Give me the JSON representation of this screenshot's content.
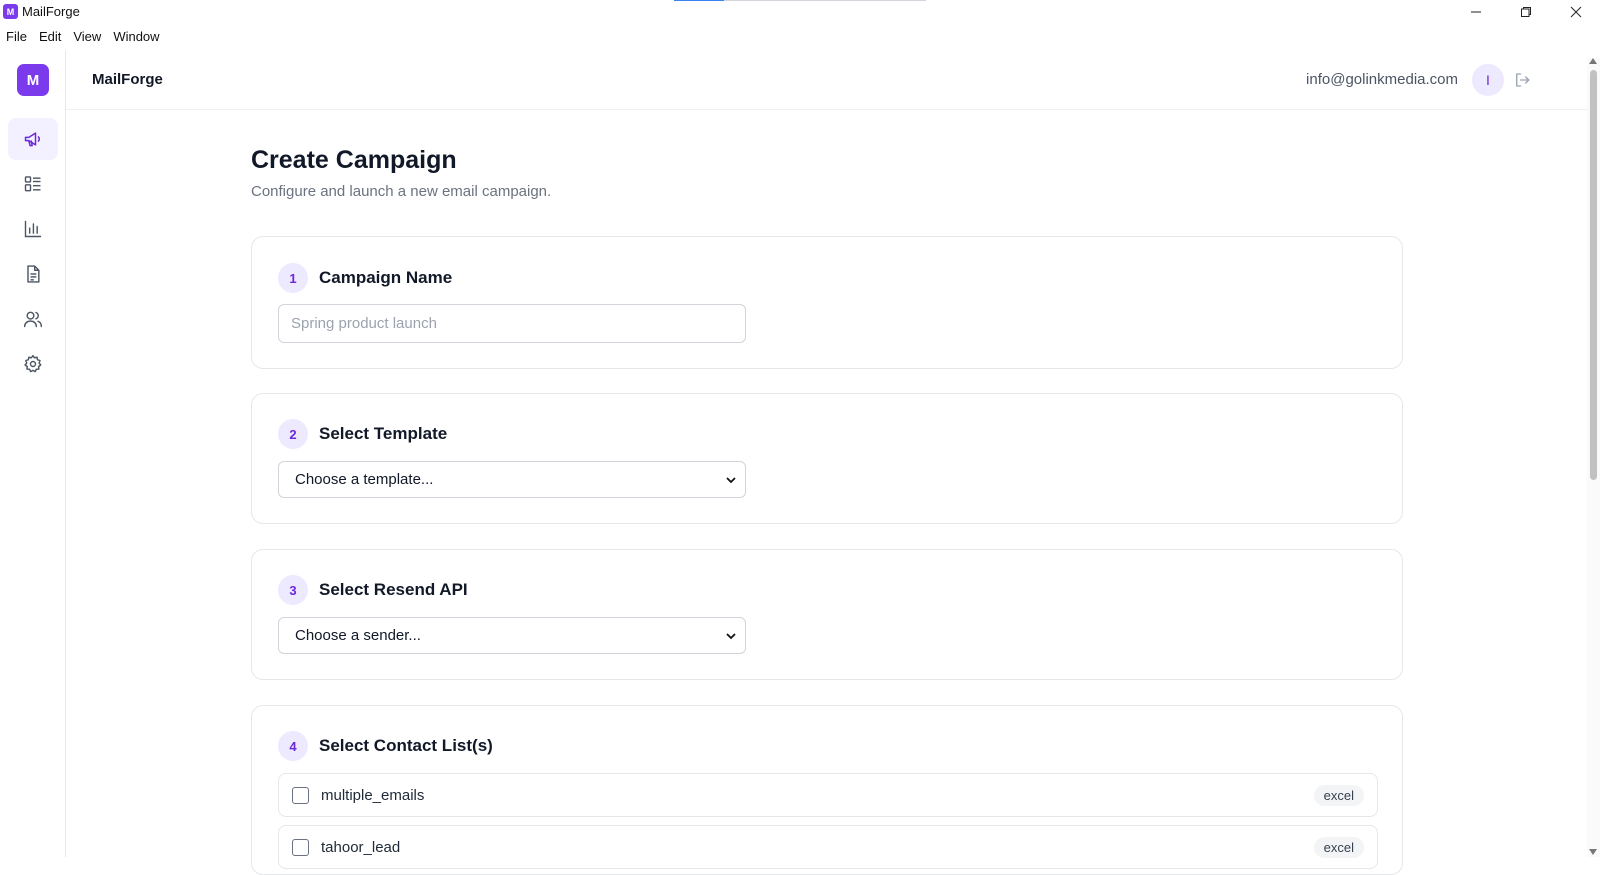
{
  "window": {
    "app_icon_letter": "M",
    "title": "MailForge",
    "loading_progress": 0.2
  },
  "menubar": {
    "items": [
      "File",
      "Edit",
      "View",
      "Window"
    ]
  },
  "sidebar": {
    "logo_letter": "M",
    "items": [
      {
        "icon": "megaphone-icon",
        "active": true
      },
      {
        "icon": "list-icon",
        "active": false
      },
      {
        "icon": "bar-chart-icon",
        "active": false
      },
      {
        "icon": "document-icon",
        "active": false
      },
      {
        "icon": "users-icon",
        "active": false
      },
      {
        "icon": "gear-icon",
        "active": false
      }
    ]
  },
  "header": {
    "brand": "MailForge",
    "user_email": "info@golinkmedia.com",
    "avatar_letter": "I"
  },
  "page": {
    "title": "Create Campaign",
    "subtitle": "Configure and launch a new email campaign."
  },
  "steps": {
    "campaign_name": {
      "number": "1",
      "title": "Campaign Name",
      "placeholder": "Spring product launch",
      "value": ""
    },
    "template": {
      "number": "2",
      "title": "Select Template",
      "selected": "Choose a template..."
    },
    "sender": {
      "number": "3",
      "title": "Select Resend API",
      "selected": "Choose a sender..."
    },
    "contacts": {
      "number": "4",
      "title": "Select Contact List(s)",
      "lists": [
        {
          "name": "multiple_emails",
          "type": "excel",
          "checked": false
        },
        {
          "name": "tahoor_lead",
          "type": "excel",
          "checked": false
        }
      ]
    }
  },
  "colors": {
    "accent": "#7c3aed",
    "accent_soft": "#ede9fe",
    "border": "#e5e7eb"
  }
}
